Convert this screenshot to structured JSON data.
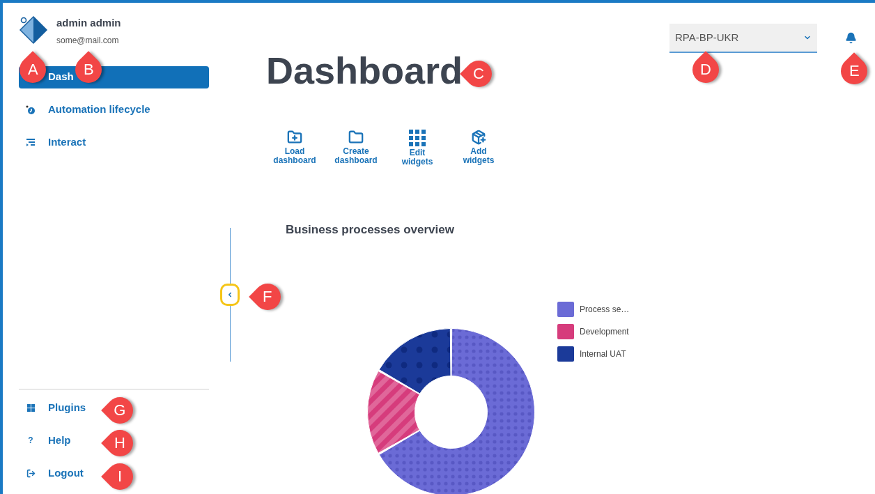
{
  "user": {
    "name": "admin admin",
    "email": "some@mail.com"
  },
  "nav": [
    {
      "kind": "dashboard",
      "label": "Dash",
      "selected": true
    },
    {
      "kind": "lifecycle",
      "label": "Automation lifecycle",
      "selected": false
    },
    {
      "kind": "interact",
      "label": "Interact",
      "selected": false
    }
  ],
  "footer_nav": [
    {
      "kind": "plugins",
      "label": "Plugins"
    },
    {
      "kind": "help",
      "glyph": "?",
      "label": "Help"
    },
    {
      "kind": "logout",
      "label": "Logout"
    }
  ],
  "page_title": "Dashboard",
  "environment": {
    "value": "RPA-BP-UKR"
  },
  "toolbar": [
    {
      "kind": "load",
      "label": "Load dashboard"
    },
    {
      "kind": "create",
      "label": "Create dashboard"
    },
    {
      "kind": "edit",
      "label": "Edit widgets"
    },
    {
      "kind": "add",
      "label": "Add widgets"
    }
  ],
  "widget": {
    "title": "Business processes overview",
    "legend": [
      {
        "label": "Process se…",
        "color": "#6b6bd6"
      },
      {
        "label": "Development",
        "color": "#d63c7c"
      },
      {
        "label": "Internal UAT",
        "color": "#1b3a99"
      }
    ]
  },
  "callouts": [
    {
      "letter": "A",
      "kind": "up"
    },
    {
      "letter": "B",
      "kind": "up"
    },
    {
      "letter": "C",
      "kind": "left"
    },
    {
      "letter": "D",
      "kind": "up"
    },
    {
      "letter": "E",
      "kind": "up"
    },
    {
      "letter": "F",
      "kind": "left"
    },
    {
      "letter": "G",
      "kind": "left"
    },
    {
      "letter": "H",
      "kind": "left"
    },
    {
      "letter": "I",
      "kind": "left"
    }
  ]
}
